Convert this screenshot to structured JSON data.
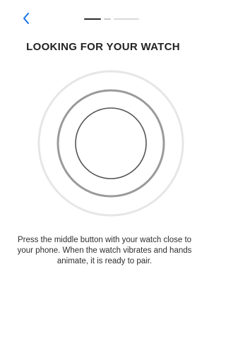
{
  "nav": {
    "back_icon": "chevron-left-icon",
    "accent": "#1a73e8"
  },
  "progress": {
    "steps": 2,
    "current": 1
  },
  "header": {
    "title": "LOOKING FOR YOUR WATCH"
  },
  "illustration": {
    "icon": "searching-rings-icon",
    "colors": {
      "outer": "#e6e6e6",
      "middle": "#9a9a9a",
      "inner": "#555555"
    }
  },
  "body": {
    "instructions": "Press the middle button with your watch close to your phone. When the watch vibrates and hands animate, it is ready to pair."
  }
}
